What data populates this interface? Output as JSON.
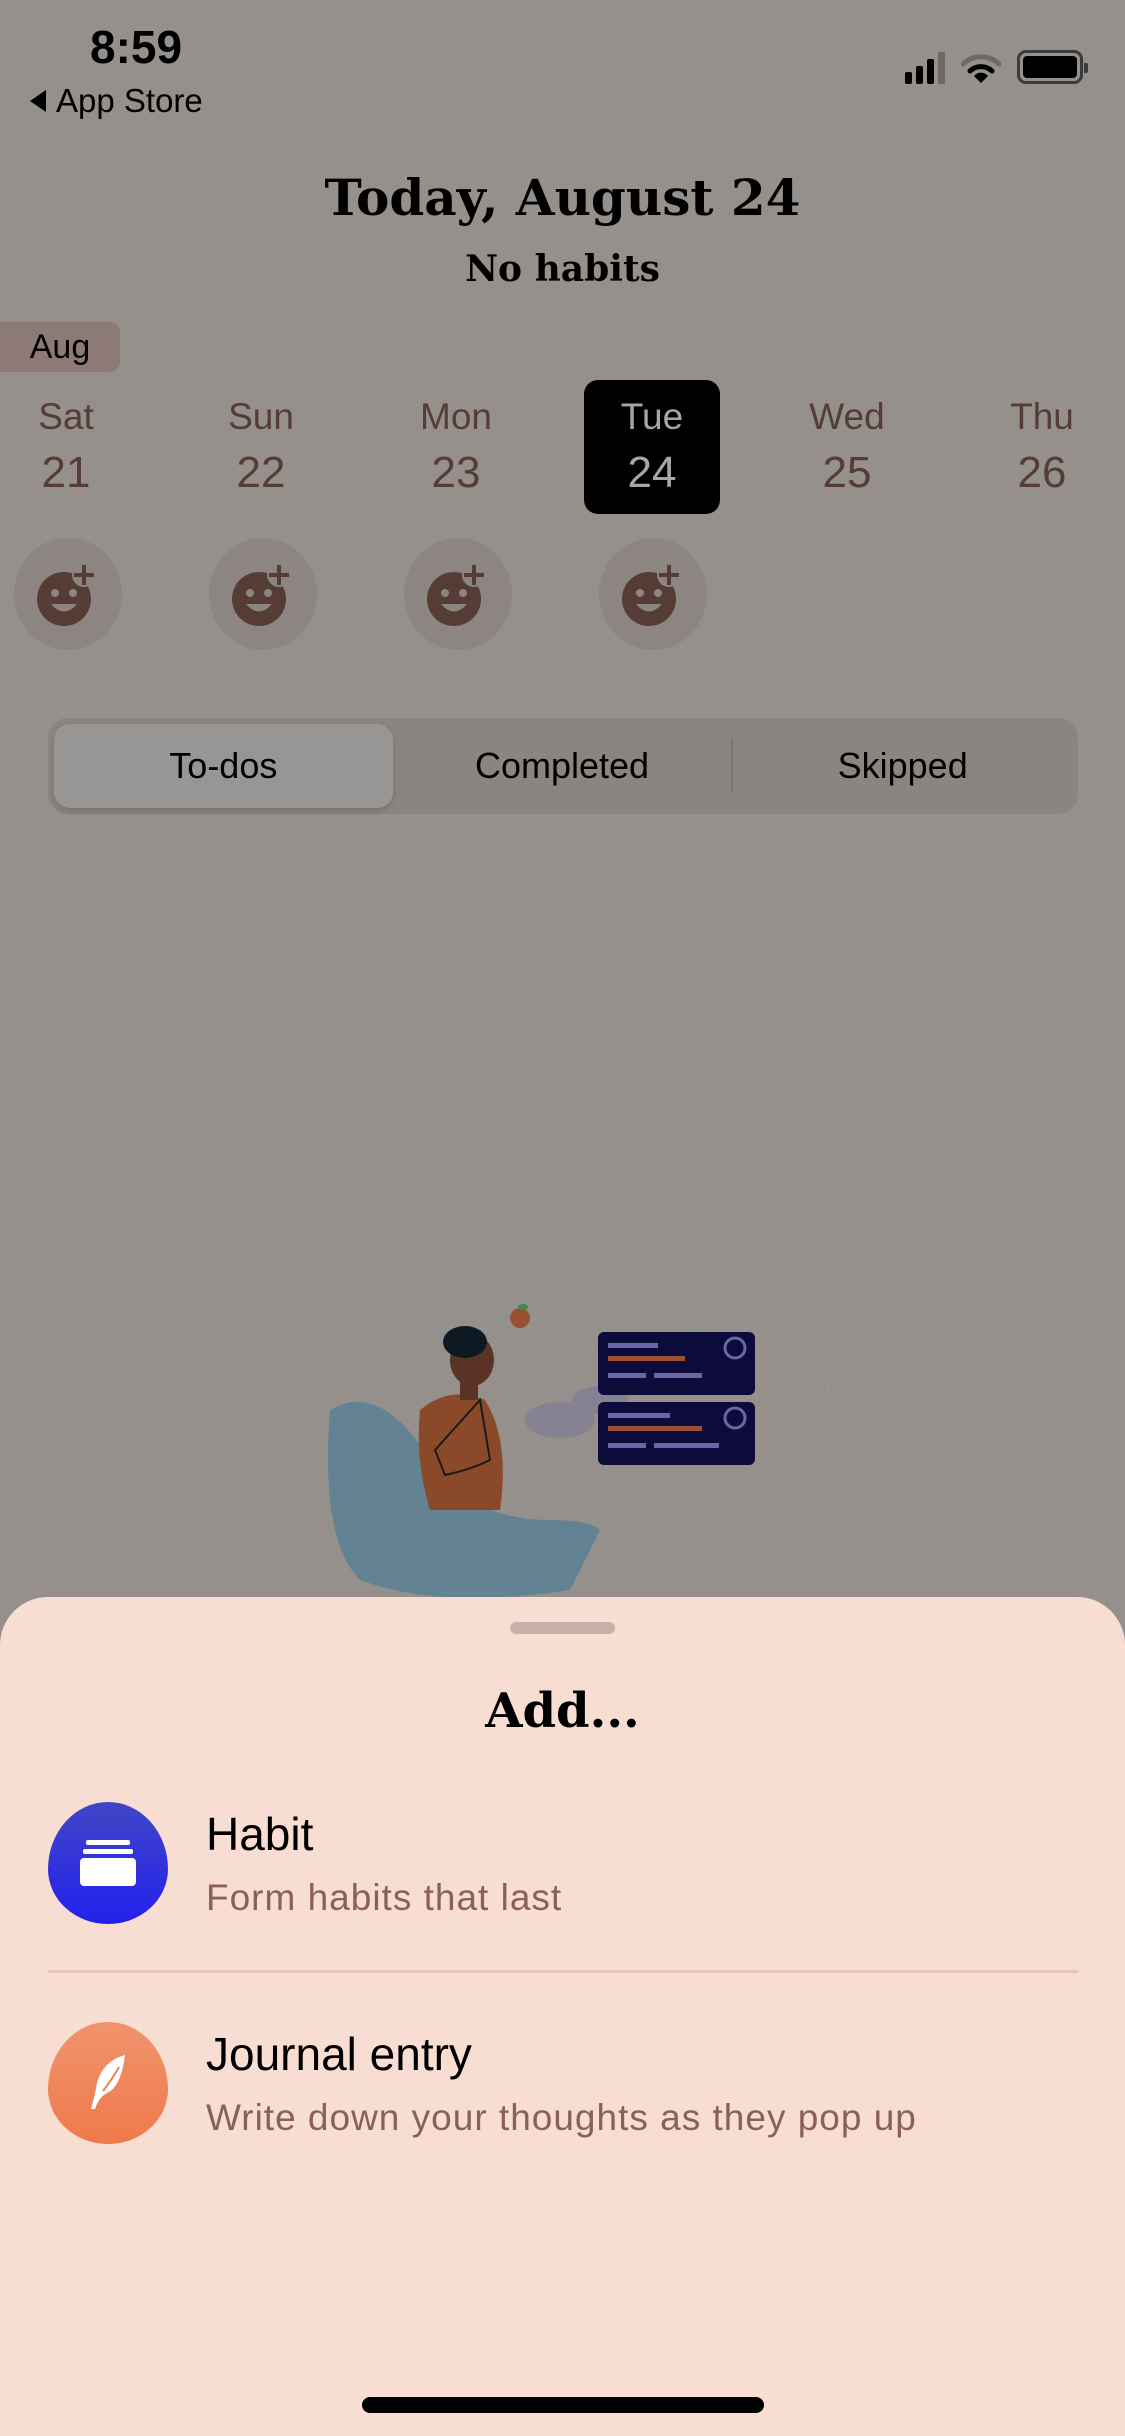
{
  "status_bar": {
    "time": "8:59",
    "back_label": "App Store",
    "icons": [
      "cellular-signal-icon",
      "wifi-icon",
      "battery-icon"
    ]
  },
  "header": {
    "title": "Today, August 24",
    "subtitle": "No habits"
  },
  "calendar": {
    "month": "Aug",
    "days": [
      {
        "name": "Sat",
        "num": "21",
        "has_mood": true
      },
      {
        "name": "Sun",
        "num": "22",
        "has_mood": true
      },
      {
        "name": "Mon",
        "num": "23",
        "has_mood": true
      },
      {
        "name": "Tue",
        "num": "24",
        "has_mood": true,
        "selected": true
      },
      {
        "name": "Wed",
        "num": "25",
        "has_mood": false
      },
      {
        "name": "Thu",
        "num": "26",
        "has_mood": false
      }
    ],
    "mood_icon": "add-mood-smiley-icon"
  },
  "segmented": {
    "tabs": [
      "To-dos",
      "Completed",
      "Skipped"
    ],
    "selected": "To-dos"
  },
  "illustration": "empty-state-person-thinking-illustration",
  "sheet": {
    "title": "Add...",
    "options": [
      {
        "title": "Habit",
        "subtitle": "Form habits that last",
        "icon": "habit-stack-icon",
        "color": "#2c2be6"
      },
      {
        "title": "Journal entry",
        "subtitle": "Write down your thoughts as they pop up",
        "icon": "feather-quill-icon",
        "color": "#ef824f"
      }
    ]
  },
  "colors": {
    "dim_background": "#95908b",
    "sheet_background": "#f8ddd3",
    "day_text": "#553d36",
    "subtitle_text": "#8a6158"
  }
}
